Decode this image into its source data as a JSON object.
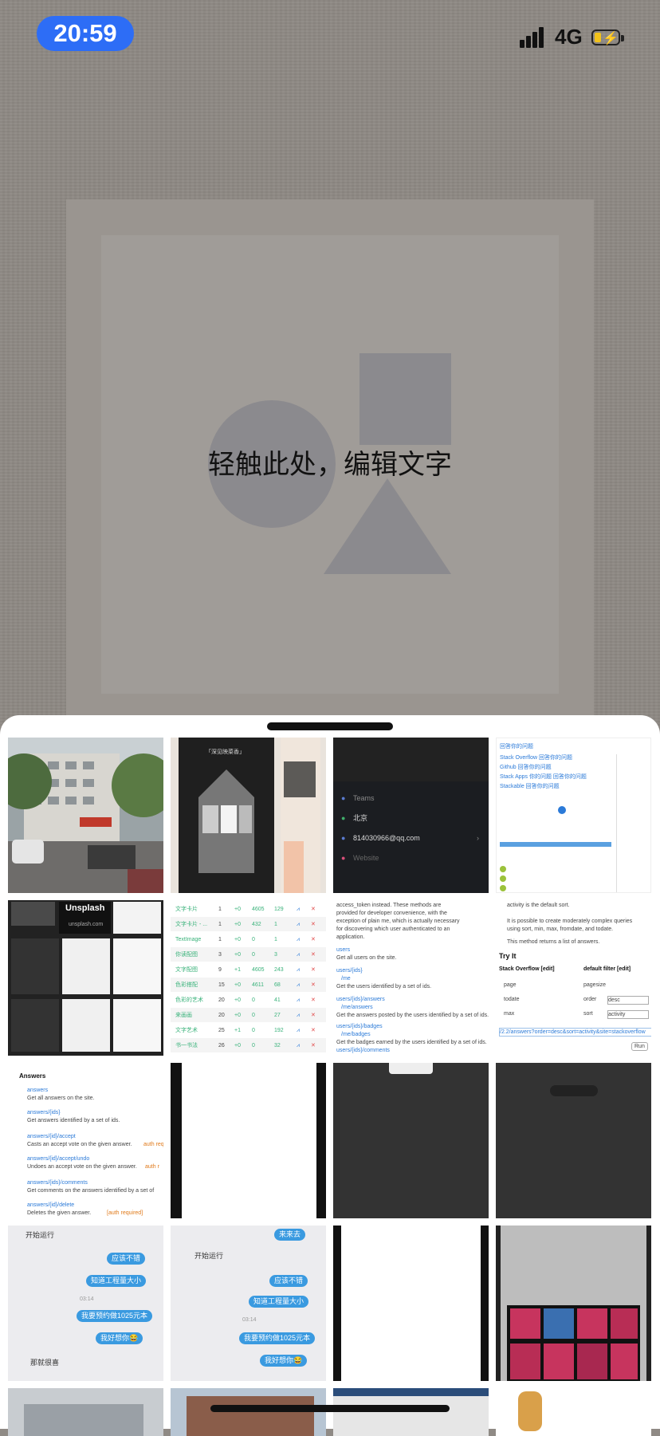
{
  "status_bar": {
    "time": "20:59",
    "network": "4G",
    "battery_level": 0.2
  },
  "canvas": {
    "edit_text_prompt": "轻触此处，编辑文字"
  },
  "photo_grid": {
    "thumb_profile": {
      "teams": "Teams",
      "city": "北京",
      "email": "814030966@qq.com",
      "website": "Website"
    },
    "thumb_unsplash": {
      "brand": "Unsplash",
      "domain": "unsplash.com"
    },
    "thumb_table": {
      "rows": [
        {
          "name": "文字卡片",
          "c1": "1",
          "c2": "+0",
          "c3": "4605",
          "c4": "129"
        },
        {
          "name": "文字卡片 - ...",
          "c1": "1",
          "c2": "+0",
          "c3": "432",
          "c4": "1"
        },
        {
          "name": "TextImage",
          "c1": "1",
          "c2": "+0",
          "c3": "0",
          "c4": "1"
        },
        {
          "name": "你读配图",
          "c1": "3",
          "c2": "+0",
          "c3": "0",
          "c4": "3"
        },
        {
          "name": "文字配图",
          "c1": "9",
          "c2": "+1",
          "c3": "4605",
          "c4": "243"
        },
        {
          "name": "色彩搭配",
          "c1": "15",
          "c2": "+0",
          "c3": "4611",
          "c4": "68"
        },
        {
          "name": "色彩的艺术",
          "c1": "20",
          "c2": "+0",
          "c3": "0",
          "c4": "41"
        },
        {
          "name": "来画画",
          "c1": "20",
          "c2": "+0",
          "c3": "0",
          "c4": "27"
        },
        {
          "name": "文字艺术",
          "c1": "25",
          "c2": "+1",
          "c3": "0",
          "c4": "192"
        },
        {
          "name": "书一书法",
          "c1": "26",
          "c2": "+0",
          "c3": "0",
          "c4": "32"
        }
      ]
    },
    "thumb_api_docs": {
      "l1": "access_token instead. These methods are",
      "l2": "provided for developer convenience, with the",
      "l3": "exception of plain me, which is actually necessary",
      "l4": "for discovering which user authenticated to an",
      "l5": "application.",
      "r1_link": "users",
      "r1_desc": "Get all users on the site.",
      "r2_link": "users/{ids}",
      "r2_sub": "/me",
      "r2_desc": "Get the users identified by a set of ids.",
      "r3_link": "users/{ids}/answers",
      "r3_sub": "/me/answers",
      "r3_desc": "Get the answers posted by the users identified by a set of ids.",
      "r4_link": "users/{ids}/badges",
      "r4_sub": "/me/badges",
      "r4_desc": "Get the badges earned by the users identified by a set of ids.",
      "r5_link": "users/{ids}/comments",
      "r5_sub": "/me/comments"
    },
    "thumb_try_it": {
      "l1": "activity is the default sort.",
      "l2": "It is possible to create moderately complex queries",
      "l3": "using sort, min, max, fromdate, and todate.",
      "l4": "This method returns a list of answers.",
      "heading": "Try It",
      "site": "Stack Overflow [edit]",
      "filter": "default filter [edit]",
      "page": "page",
      "pagesize": "pagesize",
      "todate": "todate",
      "order": "order",
      "order_val": "desc",
      "max": "max",
      "sort": "sort",
      "sort_val": "activity",
      "url": "/2.2/answers?order=desc&sort=activity&site=stackoverflow",
      "run": "Run"
    },
    "thumb_answers": {
      "heading": "Answers",
      "a1_link": "answers",
      "a1_desc": "Get all answers on the site.",
      "a2_link": "answers/{ids}",
      "a2_desc": "Get answers identified by a set of ids.",
      "a3_link": "answers/{id}/accept",
      "a3_desc": "Casts an accept vote on the given answer.",
      "a3_auth": "auth req",
      "a4_link": "answers/{id}/accept/undo",
      "a4_desc": "Undoes an accept vote on the given answer.",
      "a4_auth": "auth r",
      "a5_link": "answers/{ids}/comments",
      "a5_desc": "Get comments on the answers identified by a set of",
      "a6_link": "answers/{id}/delete",
      "a6_desc": "Deletes the given answer.",
      "a6_auth": "[auth required]"
    },
    "thumb_chat1": {
      "m1": "开始运行",
      "m2": "应该不错",
      "m3": "知道工程量大小",
      "time": "03:14",
      "m4": "我要预约做1025元本",
      "m5": "我好想你😂",
      "m6": "那就很喜"
    },
    "thumb_chat2": {
      "m0": "来来去",
      "m1": "开始运行",
      "m2": "应该不错",
      "m3": "知道工程量大小",
      "time": "03:14",
      "m4": "我要预约做1025元本",
      "m5": "我好想你😂"
    },
    "thumb_poster": {
      "title": "「深见映菜香」"
    },
    "thumb_stackapps": {
      "l1": "回答你的问题",
      "l2": "Stack Overflow 回答你的问题",
      "l3": "Github 回答你的问题",
      "l4": "Stack Apps 你的问题 回答你的问题",
      "l5": "Stackable 回答你的问题"
    }
  }
}
